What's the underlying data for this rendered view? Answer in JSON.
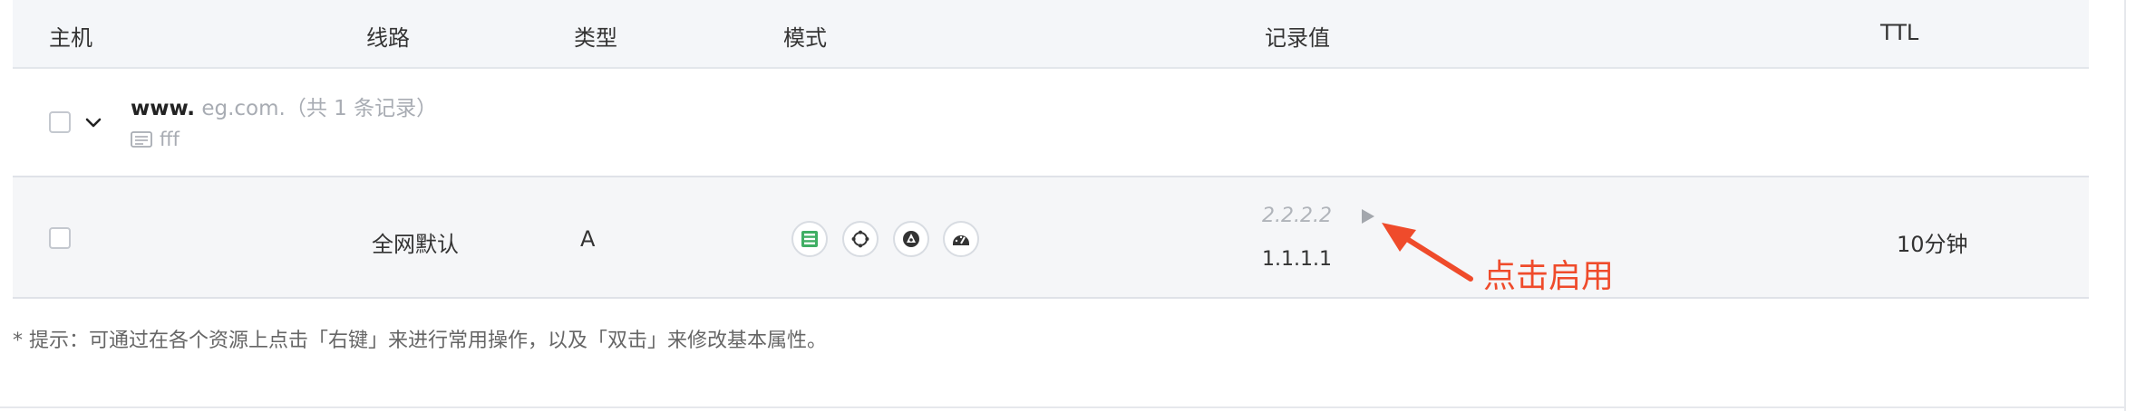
{
  "table": {
    "headers": {
      "host": "主机",
      "line": "线路",
      "type": "类型",
      "mode": "模式",
      "value": "记录值",
      "ttl": "TTL"
    },
    "group": {
      "host_name": "www.",
      "domain": "eg.com.",
      "count_label": "（共 1 条记录）",
      "remark": "fff"
    },
    "record": {
      "line": "全网默认",
      "type": "A",
      "mode_icons": [
        "load-balance-icon",
        "refresh-icon",
        "shield-icon",
        "speed-icon"
      ],
      "values": [
        {
          "value": "2.2.2.2",
          "status": "disabled"
        },
        {
          "value": "1.1.1.1",
          "status": "active"
        }
      ],
      "ttl": "10分钟"
    }
  },
  "annotation": {
    "text": "点击启用",
    "color": "#ef4b2b"
  },
  "tip": "* 提示：可通过在各个资源上点击「右键」来进行常用操作，以及「双击」来修改基本属性。"
}
